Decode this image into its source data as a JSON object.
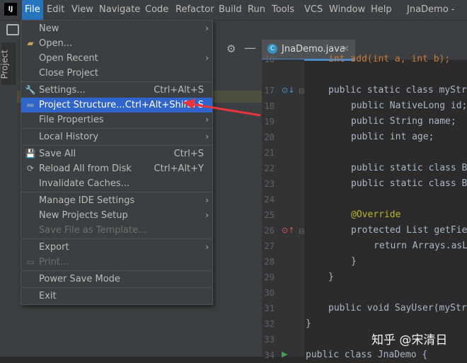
{
  "menubar": {
    "items": [
      "File",
      "Edit",
      "View",
      "Navigate",
      "Code",
      "Refactor",
      "Build",
      "Run",
      "Tools",
      "VCS",
      "Window",
      "Help"
    ],
    "window_title": "JnaDemo - Jna"
  },
  "logo": "IJ",
  "left_tool_window": {
    "label": "Project"
  },
  "editor": {
    "tab_label": "JnaDemo.java",
    "lines": [
      {
        "n": "16",
        "code": "int add(int a, int b);"
      },
      {
        "n": "17",
        "code": "public static class myStr"
      },
      {
        "n": "18",
        "code": "public NativeLong id;"
      },
      {
        "n": "19",
        "code": "public String name;"
      },
      {
        "n": "20",
        "code": "public int age;"
      },
      {
        "n": "21",
        "code": ""
      },
      {
        "n": "22",
        "code": "public static class B"
      },
      {
        "n": "23",
        "code": "public static class B"
      },
      {
        "n": "24",
        "code": ""
      },
      {
        "n": "25",
        "code": "@Override"
      },
      {
        "n": "26",
        "code": "protected List getFie"
      },
      {
        "n": "27",
        "code": "return Arrays.asL"
      },
      {
        "n": "28",
        "code": "}"
      },
      {
        "n": "29",
        "code": "}"
      },
      {
        "n": "30",
        "code": ""
      },
      {
        "n": "31",
        "code": "public void SayUser(myStr"
      },
      {
        "n": "32",
        "code": "}"
      },
      {
        "n": "33",
        "code": ""
      },
      {
        "n": "34",
        "code": "public class JnaDemo {"
      }
    ]
  },
  "file_menu": {
    "items": [
      {
        "label": "New",
        "shortcut": "",
        "submenu": true
      },
      {
        "label": "Open...",
        "shortcut": "",
        "submenu": false
      },
      {
        "label": "Open Recent",
        "shortcut": "",
        "submenu": true
      },
      {
        "label": "Close Project",
        "shortcut": "",
        "submenu": false
      },
      {
        "label": "Settings...",
        "shortcut": "Ctrl+Alt+S",
        "submenu": false
      },
      {
        "label": "Project Structure...",
        "shortcut": "Ctrl+Alt+Shift+S",
        "submenu": false
      },
      {
        "label": "File Properties",
        "shortcut": "",
        "submenu": true
      },
      {
        "label": "Local History",
        "shortcut": "",
        "submenu": true
      },
      {
        "label": "Save All",
        "shortcut": "Ctrl+S",
        "submenu": false
      },
      {
        "label": "Reload All from Disk",
        "shortcut": "Ctrl+Alt+Y",
        "submenu": false
      },
      {
        "label": "Invalidate Caches...",
        "shortcut": "",
        "submenu": false
      },
      {
        "label": "Manage IDE Settings",
        "shortcut": "",
        "submenu": true
      },
      {
        "label": "New Projects Setup",
        "shortcut": "",
        "submenu": true
      },
      {
        "label": "Save File as Template...",
        "shortcut": "",
        "submenu": false
      },
      {
        "label": "Export",
        "shortcut": "",
        "submenu": true
      },
      {
        "label": "Print...",
        "shortcut": "",
        "submenu": false
      },
      {
        "label": "Power Save Mode",
        "shortcut": "",
        "submenu": false
      },
      {
        "label": "Exit",
        "shortcut": "",
        "submenu": false
      }
    ]
  },
  "watermark": "知乎 @宋清日",
  "colors": {
    "accent": "#2f65ca",
    "menubar_active": "#2675bf",
    "annotation_arrow": "#e8343a"
  }
}
